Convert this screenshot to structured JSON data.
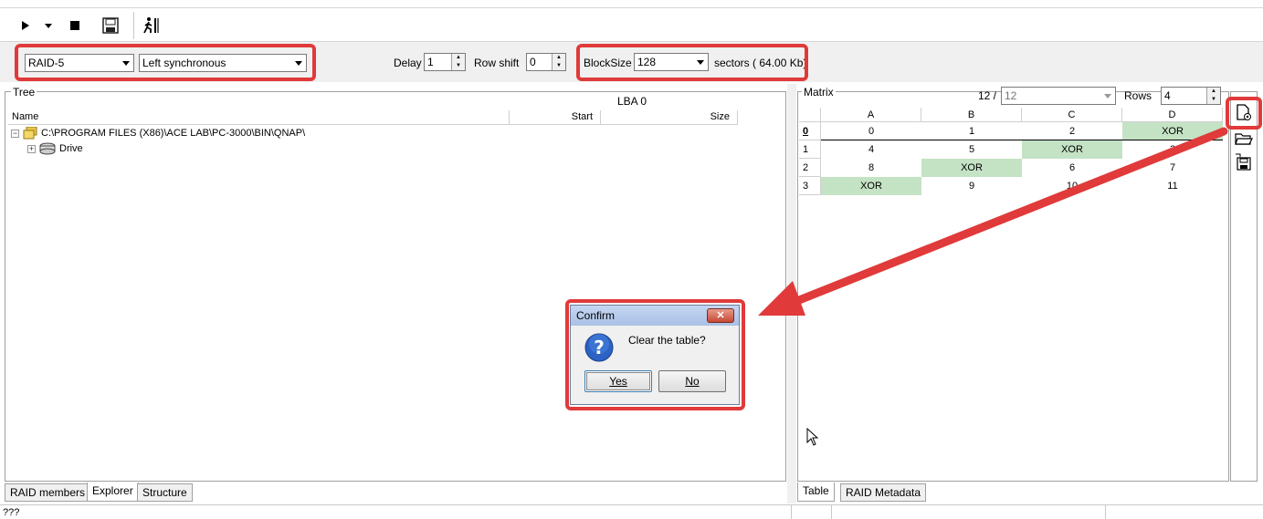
{
  "toolbar": {
    "icons": [
      "play-icon",
      "dropdown-arrow-icon",
      "stop-icon",
      "save-icon",
      "run-person-icon"
    ]
  },
  "controls": {
    "raid_type": "RAID-5",
    "raid_layout": "Left synchronous",
    "delay_label": "Delay",
    "delay_value": "1",
    "row_shift_label": "Row shift",
    "row_shift_value": "0",
    "blocksize_label": "BlockSize",
    "blocksize_value": "128",
    "blocksize_units": "sectors ( 64.00 Kb)"
  },
  "tree": {
    "title": "Tree",
    "lba_label": "LBA  0",
    "columns": [
      "Name",
      "Start",
      "Size"
    ],
    "root_path": "C:\\PROGRAM FILES (X86)\\ACE LAB\\PC-3000\\BIN\\QNAP\\",
    "child": "Drive"
  },
  "left_tabs": [
    "RAID members",
    "Explorer",
    "Structure"
  ],
  "matrix": {
    "title": "Matrix",
    "count_label": "12 /",
    "count_value": "12",
    "rows_label": "Rows",
    "rows_value": "4",
    "columns": [
      "A",
      "B",
      "C",
      "D"
    ],
    "rows": [
      {
        "label": "0",
        "cells": [
          "0",
          "1",
          "2",
          "XOR"
        ]
      },
      {
        "label": "1",
        "cells": [
          "4",
          "5",
          "XOR",
          "3"
        ]
      },
      {
        "label": "2",
        "cells": [
          "8",
          "XOR",
          "6",
          "7"
        ]
      },
      {
        "label": "3",
        "cells": [
          "XOR",
          "9",
          "10",
          "11"
        ]
      }
    ],
    "side_icons": [
      "clear-table-icon",
      "open-folder-icon",
      "save-table-icon"
    ]
  },
  "right_tabs": [
    "Table",
    "RAID Metadata"
  ],
  "dialog": {
    "title": "Confirm",
    "close": "✕",
    "message": "Clear the table?",
    "yes": "Yes",
    "no": "No"
  },
  "status": {
    "text": "???"
  },
  "colors": {
    "highlight": "#e03a3a",
    "xor_cell": "#c4e2c4"
  }
}
